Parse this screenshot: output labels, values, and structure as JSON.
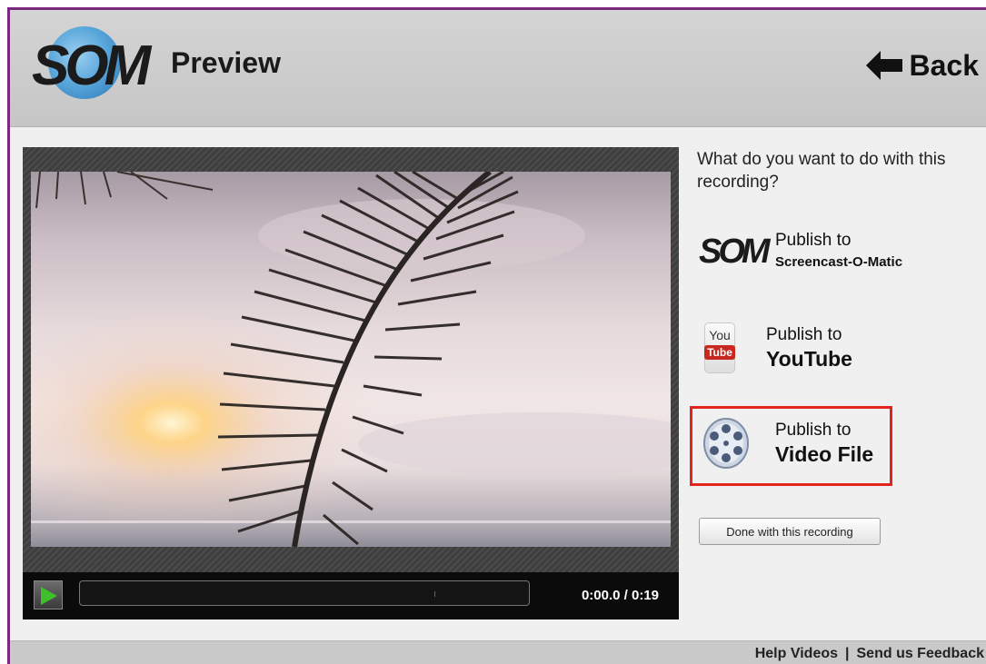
{
  "header": {
    "logo_text": "SOM",
    "title": "Preview",
    "back_label": "Back"
  },
  "player": {
    "time_display": "0:00.0 / 0:19",
    "progress_fraction": 0.0
  },
  "panel": {
    "question": "What do you want to do with this recording?",
    "options": [
      {
        "line1": "Publish to",
        "line2": "Screencast-O-Matic",
        "icon": "som-logo-icon"
      },
      {
        "line1": "Publish to",
        "line2": "YouTube",
        "icon": "youtube-icon",
        "icon_text_top": "You",
        "icon_text_bottom": "Tube"
      },
      {
        "line1": "Publish to",
        "line2": "Video File",
        "icon": "film-reel-icon",
        "highlighted": true
      }
    ],
    "done_label": "Done with this recording"
  },
  "footer": {
    "help_link": "Help Videos",
    "separator": "|",
    "feedback_link": "Send us Feedback"
  },
  "colors": {
    "highlight_border": "#e4231f",
    "frame_border": "#7a2a7e",
    "play_icon": "#3fbf2a"
  }
}
